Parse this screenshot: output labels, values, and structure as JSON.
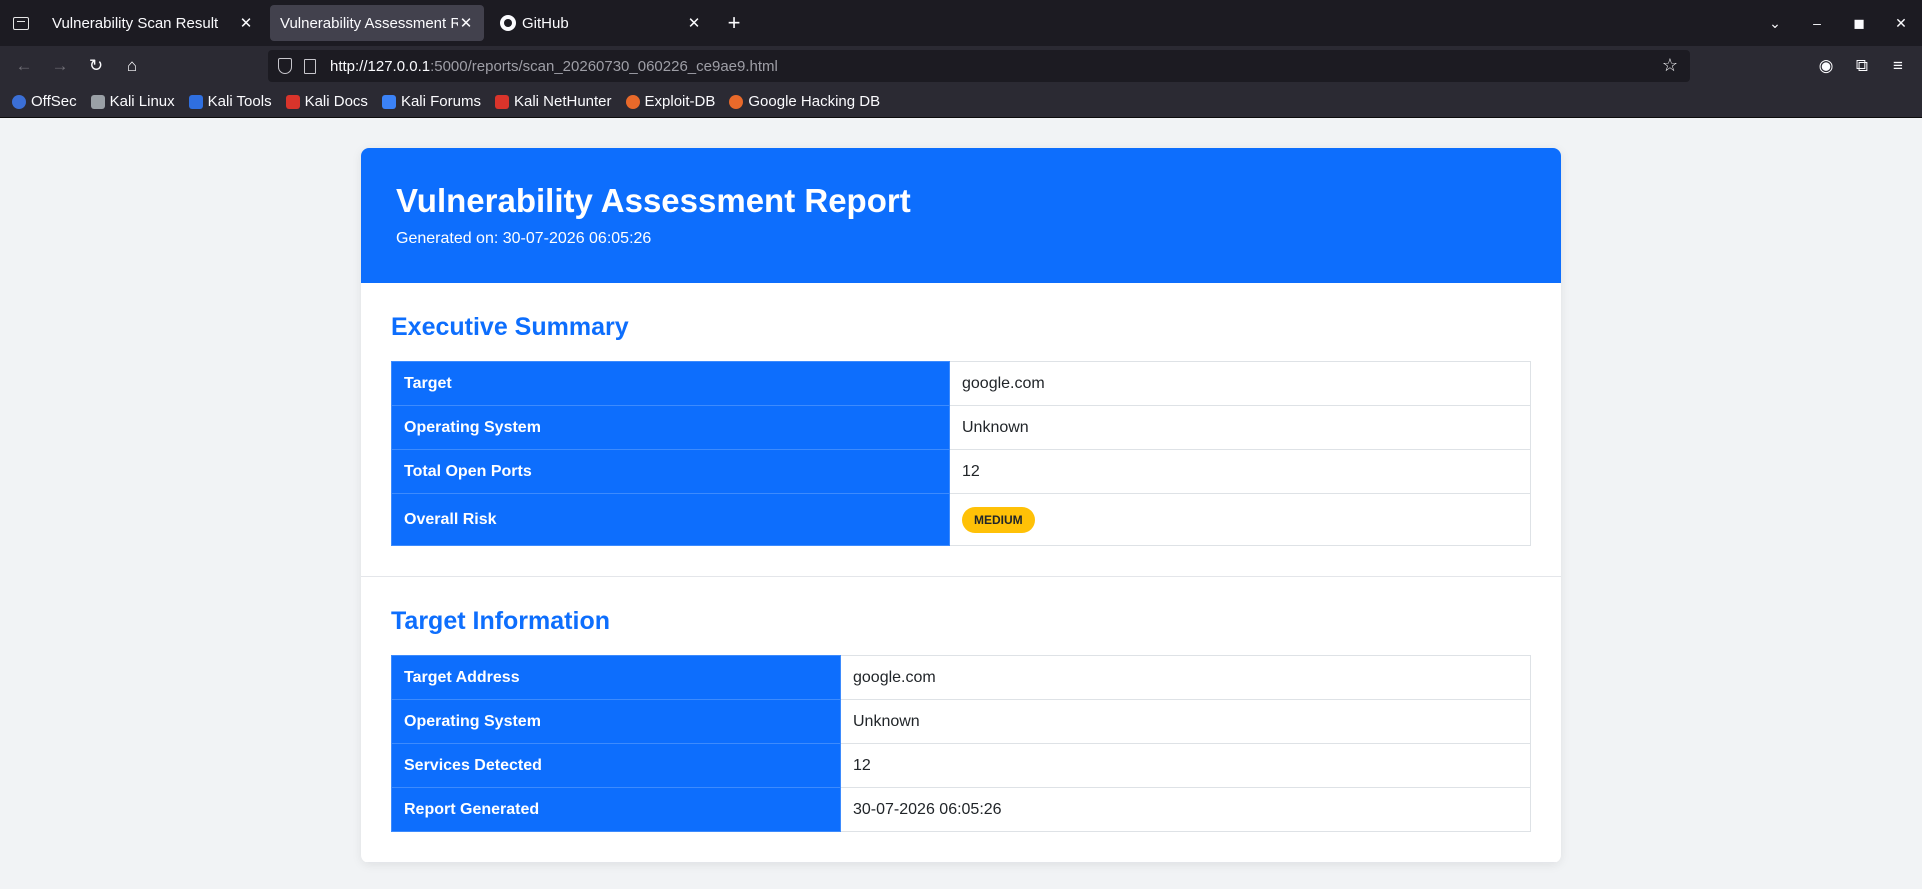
{
  "browser": {
    "tabs": [
      {
        "title": "Vulnerability Scan Result",
        "active": false
      },
      {
        "title": "Vulnerability Assessment Rep",
        "active": true
      },
      {
        "title": "GitHub",
        "active": false
      }
    ],
    "url_host": "http://127.0.0.1",
    "url_rest": ":5000/reports/scan_20260730_060226_ce9ae9.html",
    "bookmarks": [
      {
        "label": "OffSec",
        "color": "#3b6fd6"
      },
      {
        "label": "Kali Linux",
        "color": "#9aa0a6"
      },
      {
        "label": "Kali Tools",
        "color": "#2f6fe0"
      },
      {
        "label": "Kali Docs",
        "color": "#d9342b"
      },
      {
        "label": "Kali Forums",
        "color": "#3b82f6"
      },
      {
        "label": "Kali NetHunter",
        "color": "#d9342b"
      },
      {
        "label": "Exploit-DB",
        "color": "#e8692a"
      },
      {
        "label": "Google Hacking DB",
        "color": "#e8692a"
      }
    ]
  },
  "report": {
    "title": "Vulnerability Assessment Report",
    "generated": "Generated on: 30-07-2026 06:05:26",
    "accent_color": "#0d6efd",
    "executive_summary": {
      "heading": "Executive Summary",
      "rows": [
        {
          "label": "Target",
          "value": "google.com"
        },
        {
          "label": "Operating System",
          "value": "Unknown"
        },
        {
          "label": "Total Open Ports",
          "value": "12"
        },
        {
          "label": "Overall Risk",
          "value": "MEDIUM",
          "badge_color": "#ffc107"
        }
      ]
    },
    "target_information": {
      "heading": "Target Information",
      "rows": [
        {
          "label": "Target Address",
          "value": "google.com"
        },
        {
          "label": "Operating System",
          "value": "Unknown"
        },
        {
          "label": "Services Detected",
          "value": "12"
        },
        {
          "label": "Report Generated",
          "value": "30-07-2026 06:05:26"
        }
      ]
    }
  }
}
